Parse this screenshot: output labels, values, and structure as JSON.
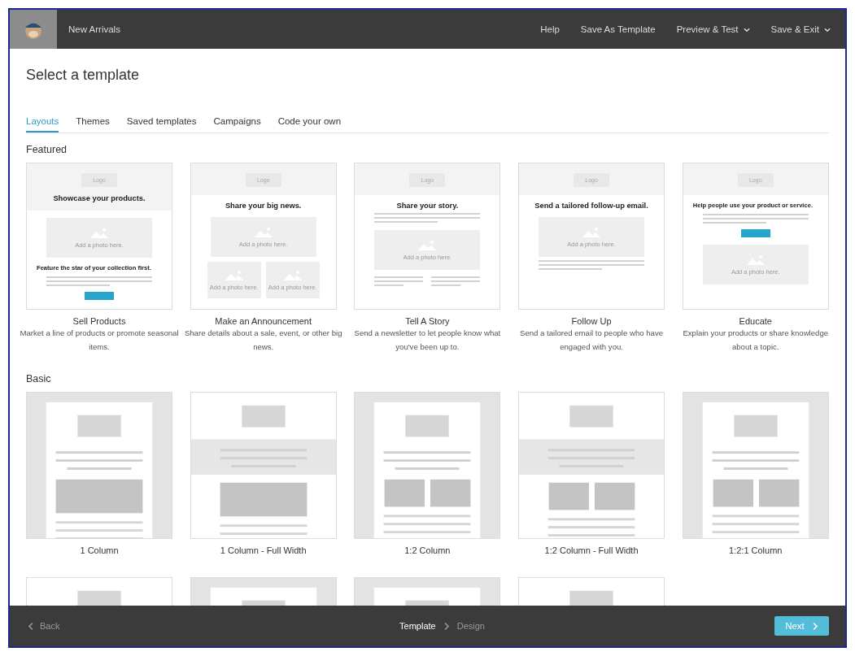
{
  "header": {
    "title": "New Arrivals",
    "menu": [
      {
        "label": "Help",
        "dropdown": false
      },
      {
        "label": "Save As Template",
        "dropdown": false
      },
      {
        "label": "Preview & Test",
        "dropdown": true
      },
      {
        "label": "Save & Exit",
        "dropdown": true
      }
    ]
  },
  "page_title": "Select a template",
  "tabs": [
    {
      "label": "Layouts",
      "selected": true
    },
    {
      "label": "Themes",
      "selected": false
    },
    {
      "label": "Saved templates",
      "selected": false
    },
    {
      "label": "Campaigns",
      "selected": false
    },
    {
      "label": "Code your own",
      "selected": false
    }
  ],
  "featured": {
    "heading": "Featured",
    "templates": [
      {
        "name": "Sell Products",
        "description": "Market a line of products or promote seasonal items.",
        "preview": [
          {
            "kind": "band",
            "logo": "Logo",
            "headline": "Showcase your products."
          },
          {
            "kind": "photo",
            "caption": "Add a photo here."
          },
          {
            "kind": "subhead",
            "text": "Feature the star of your collection first."
          },
          {
            "kind": "lines"
          },
          {
            "kind": "button"
          }
        ]
      },
      {
        "name": "Make an Announcement",
        "description": "Share details about a sale, event, or other big news.",
        "preview": [
          {
            "kind": "band",
            "logo": "Logo"
          },
          {
            "kind": "headline",
            "text": "Share your big news."
          },
          {
            "kind": "photo",
            "caption": "Add a photo here."
          },
          {
            "kind": "photos2",
            "captions": [
              "Add a photo here.",
              "Add a photo here."
            ]
          }
        ]
      },
      {
        "name": "Tell A Story",
        "description": "Send a newsletter to let people know what you've been up to.",
        "preview": [
          {
            "kind": "band",
            "logo": "Logo"
          },
          {
            "kind": "headline",
            "text": "Share your story."
          },
          {
            "kind": "lines"
          },
          {
            "kind": "photo",
            "caption": "Add a photo here."
          },
          {
            "kind": "columns"
          }
        ]
      },
      {
        "name": "Follow Up",
        "description": "Send a tailored email to people who have engaged with you.",
        "preview": [
          {
            "kind": "band",
            "logo": "Logo"
          },
          {
            "kind": "headline",
            "text": "Send a tailored follow-up email."
          },
          {
            "kind": "photo",
            "caption": "Add a photo here."
          },
          {
            "kind": "lines"
          }
        ]
      },
      {
        "name": "Educate",
        "description": "Explain your products or share knowledge about a topic.",
        "preview": [
          {
            "kind": "band",
            "logo": "Logo"
          },
          {
            "kind": "subhead",
            "text": "Help people use your product or service."
          },
          {
            "kind": "lines"
          },
          {
            "kind": "button"
          },
          {
            "kind": "photo",
            "caption": "Add a photo here."
          }
        ]
      }
    ]
  },
  "basic": {
    "heading": "Basic",
    "layouts": [
      {
        "name": "1 Column",
        "kind": "one"
      },
      {
        "name": "1 Column - Full Width",
        "kind": "one-full"
      },
      {
        "name": "1:2 Column",
        "kind": "two"
      },
      {
        "name": "1:2 Column - Full Width",
        "kind": "two-full"
      },
      {
        "name": "1:2:1 Column",
        "kind": "two-one"
      }
    ],
    "more_layouts": [
      {
        "kind": "one-full"
      },
      {
        "kind": "one"
      },
      {
        "kind": "two"
      },
      {
        "kind": "two-full"
      }
    ]
  },
  "footer": {
    "back": "Back",
    "steps": [
      {
        "label": "Template",
        "selected": true
      },
      {
        "label": "Design",
        "selected": false
      }
    ],
    "next": "Next"
  }
}
